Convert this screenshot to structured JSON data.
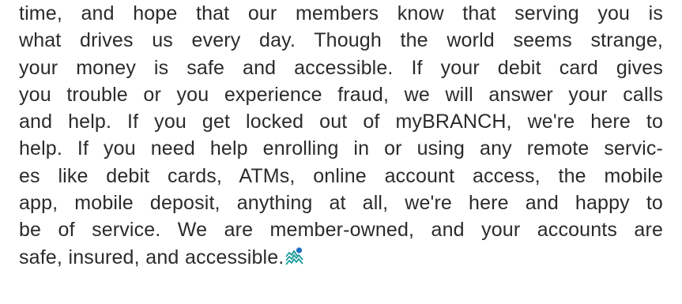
{
  "article": {
    "lines": [
      "time, and hope that our members know that serving you is",
      "what drives us every day. Though the world seems strange,",
      "your money is safe and accessible.  If your debit card gives",
      "you trouble or you experience fraud, we will answer your calls",
      "and help.  If you get locked out of myBRANCH, we're here to",
      "help. If you need help enrolling in or using any remote servic-",
      "es like debit cards, ATMs, online account access, the mobile",
      "app, mobile deposit, anything at all, we're here and happy to",
      "be of service. We are member-owned, and your accounts are",
      "safe, insured, and accessible."
    ],
    "end_mark_icon": "mountains-sun-logo-icon"
  },
  "colors": {
    "text": "#2b2b2b",
    "logo_teal": "#1a9a9a",
    "logo_blue": "#1f6fc1"
  }
}
